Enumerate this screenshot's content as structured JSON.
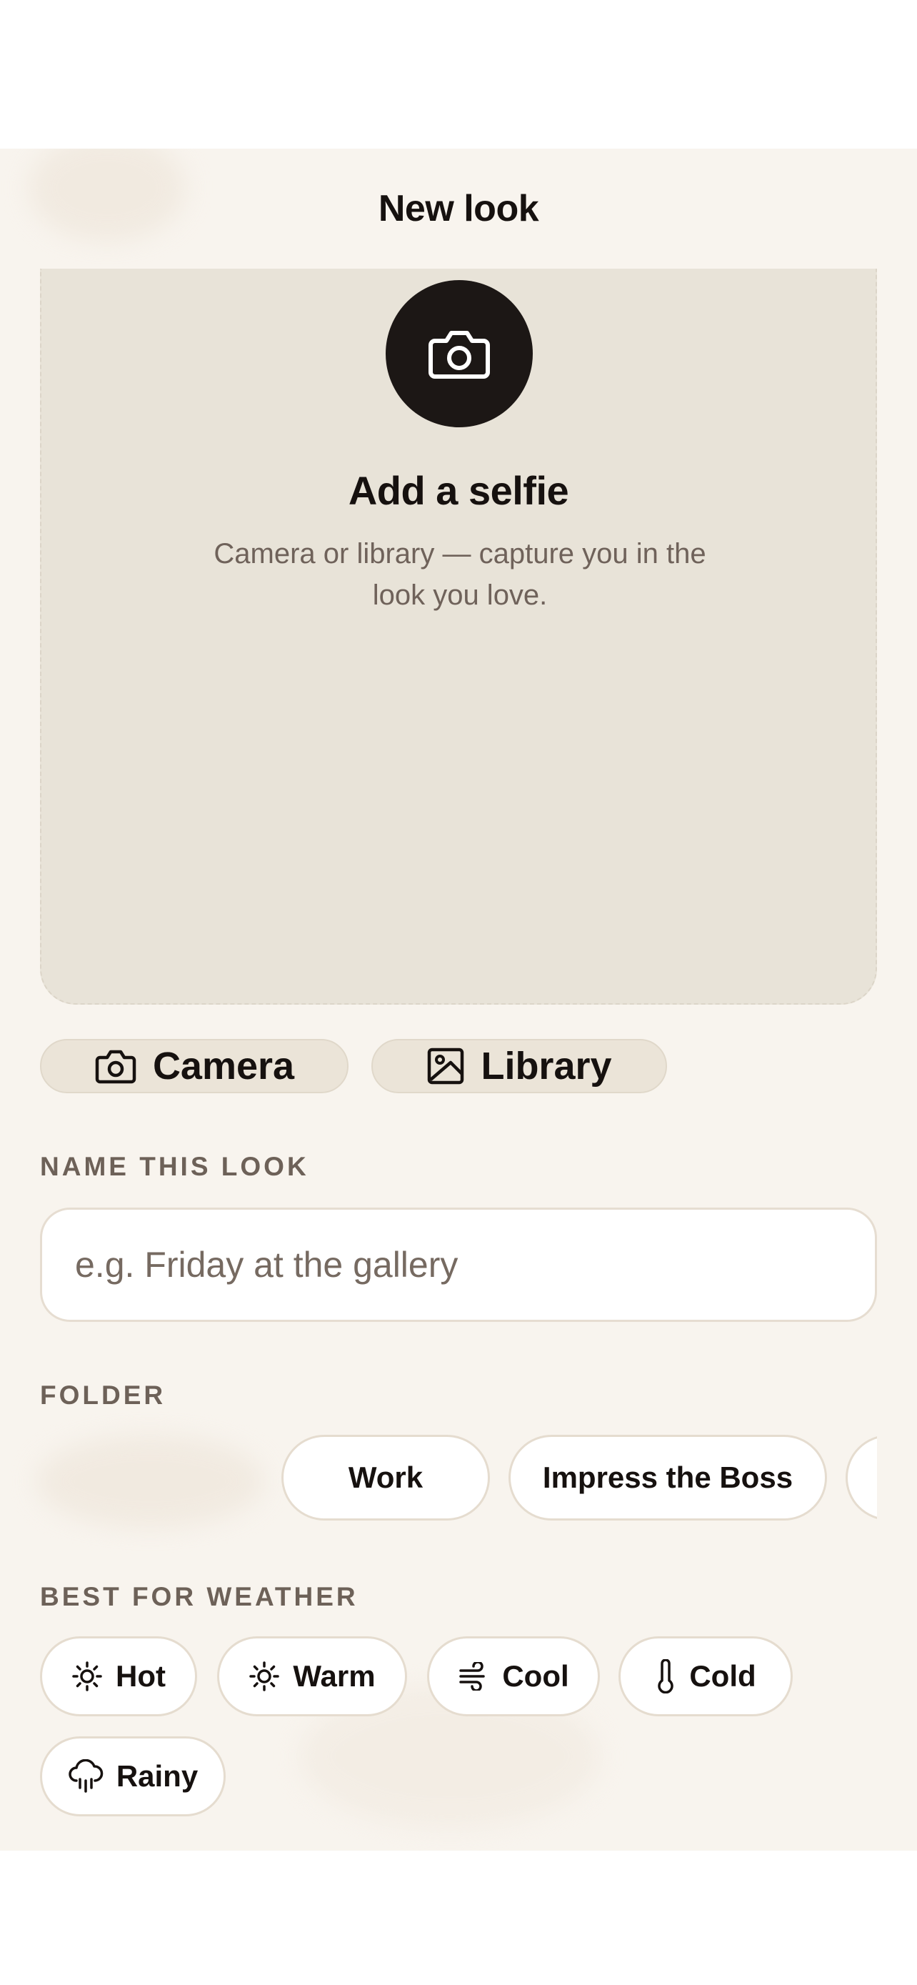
{
  "header": {
    "title": "New look"
  },
  "selfie_card": {
    "icon": "camera-icon",
    "title": "Add a selfie",
    "subtitle": "Camera or library — capture you in the look you love."
  },
  "source_buttons": [
    {
      "label": "Camera",
      "icon": "camera-icon"
    },
    {
      "label": "Library",
      "icon": "image-icon"
    }
  ],
  "name_section": {
    "label": "NAME THIS LOOK",
    "value": "",
    "placeholder": "e.g. Friday at the gallery"
  },
  "folder_section": {
    "label": "FOLDER",
    "chips": [
      "Work",
      "Impress the Boss"
    ]
  },
  "weather_section": {
    "label": "BEST FOR WEATHER",
    "chips": [
      {
        "label": "Hot",
        "icon": "sun-icon"
      },
      {
        "label": "Warm",
        "icon": "sun-icon"
      },
      {
        "label": "Cool",
        "icon": "wind-icon"
      },
      {
        "label": "Cold",
        "icon": "thermometer-icon"
      },
      {
        "label": "Rainy",
        "icon": "rain-cloud-icon"
      }
    ]
  },
  "colors": {
    "background": "#f8f4ee",
    "card": "#e8e3d8",
    "accent_dark": "#1c1715",
    "label_muted": "#6d6158"
  }
}
